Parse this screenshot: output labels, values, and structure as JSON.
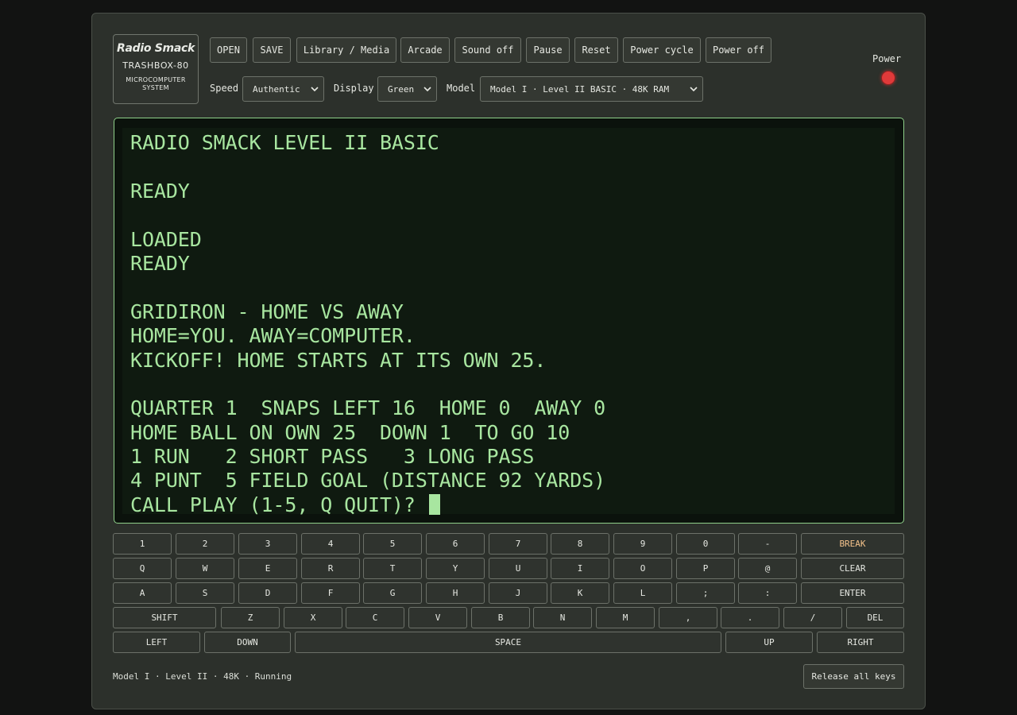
{
  "logo": {
    "brand": "Radio Smack",
    "model": "TRASHBOX-80",
    "sub_line1": "MICROCOMPUTER",
    "sub_line2": "SYSTEM"
  },
  "toolbar": {
    "open": "OPEN",
    "save": "SAVE",
    "library": "Library / Media",
    "arcade": "Arcade",
    "sound": "Sound off",
    "pause": "Pause",
    "reset": "Reset",
    "power_cycle": "Power cycle",
    "power_off": "Power off"
  },
  "settings": {
    "speed_label": "Speed",
    "speed_value": "Authentic",
    "display_label": "Display",
    "display_value": "Green",
    "model_label": "Model",
    "model_value": "Model I · Level II BASIC · 48K RAM"
  },
  "power": {
    "label": "Power",
    "led_color": "#e03a3a"
  },
  "screen": {
    "phosphor_color": "#a8e6a0",
    "lines": [
      "RADIO SMACK LEVEL II BASIC",
      "",
      "READY",
      "",
      "LOADED",
      "READY",
      "",
      "GRIDIRON - HOME VS AWAY",
      "HOME=YOU. AWAY=COMPUTER.",
      "KICKOFF! HOME STARTS AT ITS OWN 25.",
      "",
      "QUARTER 1  SNAPS LEFT 16  HOME 0  AWAY 0",
      "HOME BALL ON OWN 25  DOWN 1  TO GO 10",
      "1 RUN   2 SHORT PASS   3 LONG PASS",
      "4 PUNT  5 FIELD GOAL (DISTANCE 92 YARDS)",
      "CALL PLAY (1-5, Q QUIT)? "
    ]
  },
  "keyboard": {
    "row1": [
      "1",
      "2",
      "3",
      "4",
      "5",
      "6",
      "7",
      "8",
      "9",
      "0",
      "-",
      "BREAK"
    ],
    "row2": [
      "Q",
      "W",
      "E",
      "R",
      "T",
      "Y",
      "U",
      "I",
      "O",
      "P",
      "@",
      "CLEAR"
    ],
    "row3": [
      "A",
      "S",
      "D",
      "F",
      "G",
      "H",
      "J",
      "K",
      "L",
      ";",
      ":",
      "ENTER"
    ],
    "row4": [
      "SHIFT",
      "Z",
      "X",
      "C",
      "V",
      "B",
      "N",
      "M",
      ",",
      ".",
      "/",
      "DEL"
    ],
    "row5": [
      "LEFT",
      "DOWN",
      "SPACE",
      "UP",
      "RIGHT"
    ]
  },
  "footer": {
    "status": "Model I · Level II · 48K · Running",
    "release_keys": "Release all keys"
  }
}
